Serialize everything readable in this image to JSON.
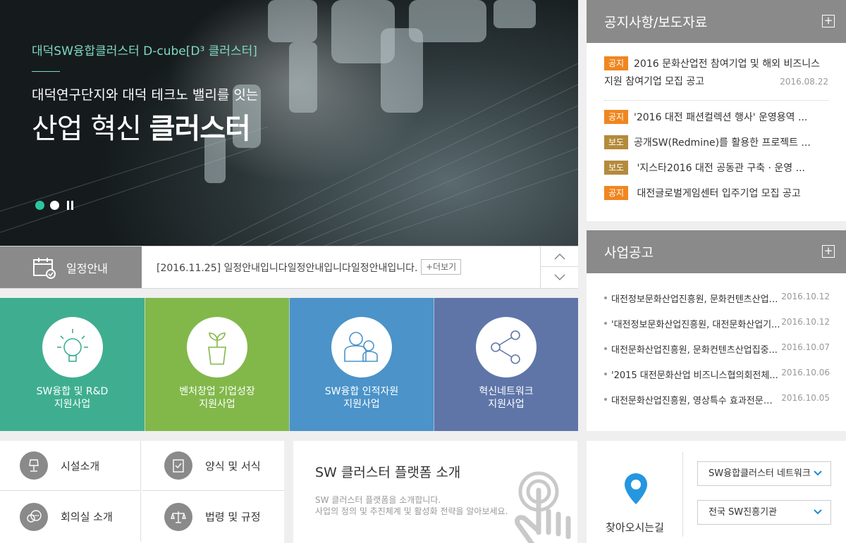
{
  "hero": {
    "subtitle": "대덕SW융합클러스터 D-cube[D³ 클러스터]",
    "desc": "대덕연구단지와 대덕 테크노 밸리를 잇는",
    "title_plain": "산업 혁신 ",
    "title_bold": "클러스터"
  },
  "schedule": {
    "label": "일정안내",
    "text": "[2016.11.25]   일정안내입니다일정안내입니다일정안내입니다.",
    "more": "+더보기"
  },
  "tiles": [
    {
      "line1": "SW융합 및 R&D",
      "line2": "지원사업",
      "color": "#3fae90"
    },
    {
      "line1": "벤처창업 기업성장",
      "line2": "지원사업",
      "color": "#82b84a"
    },
    {
      "line1": "SW융합 인적자원",
      "line2": "지원사업",
      "color": "#4b93c9"
    },
    {
      "line1": "혁신네트워크",
      "line2": "지원사업",
      "color": "#5f75a8"
    }
  ],
  "links": [
    "시설소개",
    "양식 및 서식",
    "회의실 소개",
    "법령 및 규정"
  ],
  "platform": {
    "title": "SW 클러스터 플랫폼 소개",
    "desc1": "SW 클러스터 플랫폼을 소개합니다.",
    "desc2": "사업의 정의 및 추진체계 및 활성화 전략을 알아보세요."
  },
  "notice": {
    "title": "공지사항/보도자료",
    "first": {
      "badge": "공지",
      "text": "2016 문화산업전 참여기업 및 해외 비즈니스 지원 참여기업 모집 공고",
      "date": "2016.08.22"
    },
    "items": [
      {
        "badge": "공지",
        "text": "'2016 대전 패션컬렉션 행사' 운영용역 ..."
      },
      {
        "badge": "보도",
        "text": "공개SW(Redmine)를 활용한 프로젝트 ..."
      },
      {
        "badge": "보도",
        "text": " '지스타2016 대전 공동관 구축 · 운영 ..."
      },
      {
        "badge": "공지",
        "text": " 대전글로벌게임센터 입주기업 모집 공고"
      }
    ]
  },
  "biz": {
    "title": "사업공고",
    "items": [
      {
        "text": "대전정보문화산업진흥원, 문화컨텐츠산업 ...",
        "date": "2016.10.12"
      },
      {
        "text": "'대전정보문화산업진흥원, 대전문화산업기...",
        "date": "2016.10.12"
      },
      {
        "text": "대전문화산업진흥원, 문화컨텐츠산업집중...",
        "date": "2016.10.07"
      },
      {
        "text": "'2015 대전문화산업 비즈니스협의회전체...",
        "date": "2016.10.06"
      },
      {
        "text": "대전문화산업진흥원, 영상특수 효과전문가...",
        "date": "2016.10.05"
      }
    ]
  },
  "directions": {
    "label": "찾아오시는길",
    "select1": "SW융합클러스터 네트워크",
    "select2": "전국 SW진흥기관"
  }
}
